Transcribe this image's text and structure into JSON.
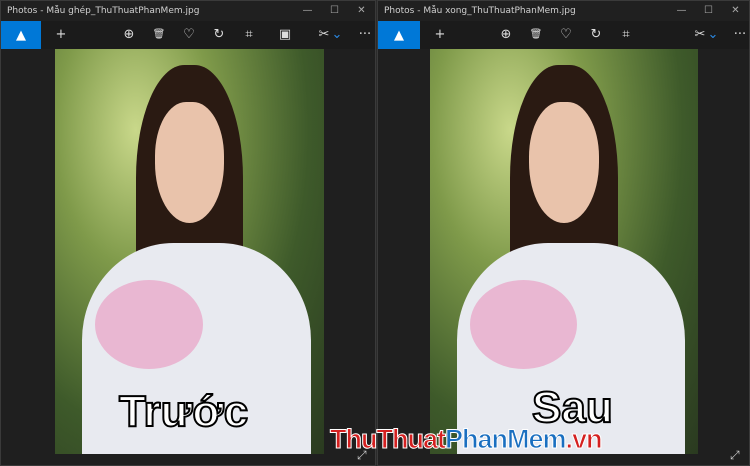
{
  "left": {
    "title": "Photos - Mẫu ghép_ThuThuatPhanMem.jpg",
    "caption": "Trước"
  },
  "right": {
    "title": "Photos - Mẫu xong_ThuThuatPhanMem.jpg",
    "caption": "Sau"
  },
  "controls": {
    "minimize": "—",
    "maximize": "☐",
    "close": "✕"
  },
  "toolbar": {
    "add": "+",
    "zoom": "⊕",
    "delete": "🗑",
    "favorite": "♡",
    "rotate": "↻",
    "crop": "⌗",
    "focus": "▣",
    "edit": "✂",
    "dropdown": "⌄",
    "more": "···",
    "home": "▲"
  },
  "expand": "⤢",
  "watermark": {
    "part1": "ThuThuat",
    "part2": "PhanMem",
    "part3": ".vn"
  },
  "colors": {
    "accent": "#0078d7"
  }
}
